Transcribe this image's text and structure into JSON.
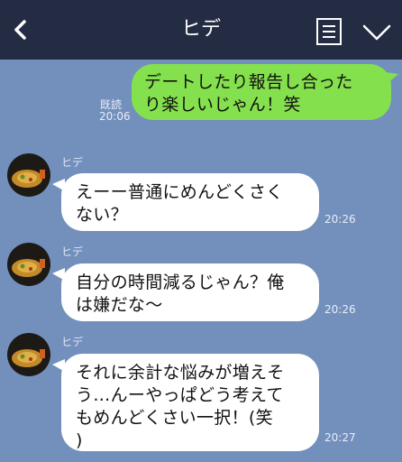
{
  "header": {
    "title": "ヒデ",
    "bg_color": "#232c43"
  },
  "colors": {
    "chat_bg": "#7390bd",
    "outgoing_bubble": "#84e04c",
    "incoming_bubble": "#ffffff"
  },
  "icons": {
    "back": "chevron-left-icon",
    "notes": "notes-icon",
    "menu": "chevron-down-icon"
  },
  "messages": [
    {
      "direction": "outgoing",
      "lines": [
        "デートしたり報告し合った",
        "り楽しいじゃん！笑"
      ],
      "read": "既読",
      "time": "20:06"
    },
    {
      "direction": "incoming",
      "sender": "ヒデ",
      "lines": [
        "えーー普通にめんどくさく",
        "ない？"
      ],
      "time": "20:26"
    },
    {
      "direction": "incoming",
      "sender": "ヒデ",
      "lines": [
        "自分の時間減るじゃん？俺",
        "は嫌だな〜"
      ],
      "time": "20:26"
    },
    {
      "direction": "incoming",
      "sender": "ヒデ",
      "lines": [
        "それに余計な悩みが増えそ",
        "う…んーやっぱどう考えて",
        "もめんどくさい一択！(笑",
        ")"
      ],
      "time": "20:27"
    }
  ]
}
